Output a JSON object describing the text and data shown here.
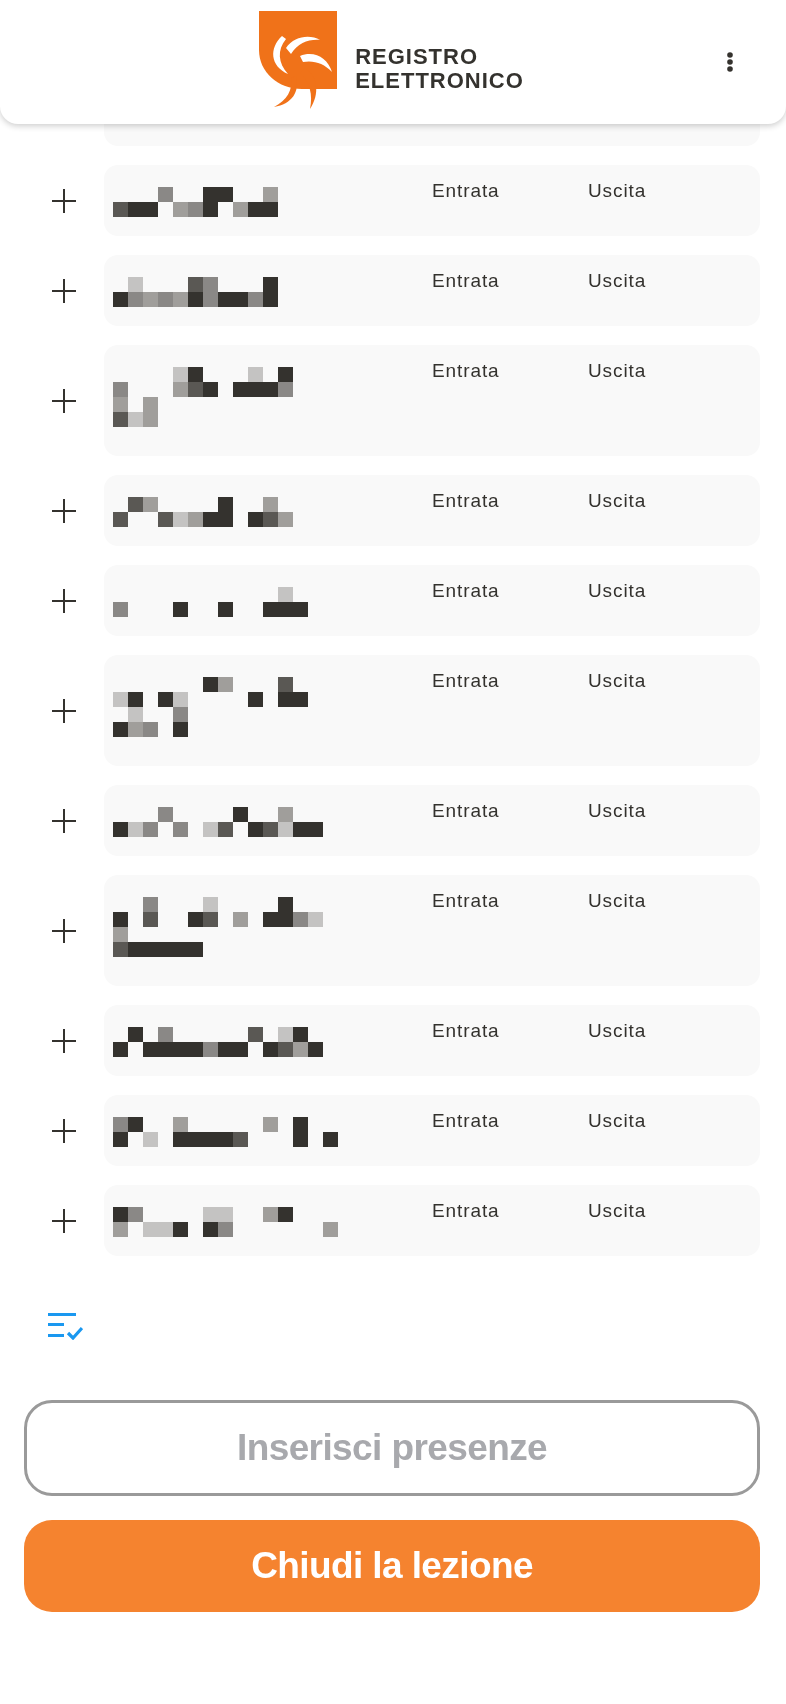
{
  "header": {
    "title": "REGISTRO ELETTRONICO"
  },
  "rows": [
    {
      "wrapped": false,
      "entry_label": "Entrata",
      "exit_label": "Uscita"
    },
    {
      "wrapped": false,
      "entry_label": "Entrata",
      "exit_label": "Uscita"
    },
    {
      "wrapped": true,
      "entry_label": "Entrata",
      "exit_label": "Uscita"
    },
    {
      "wrapped": false,
      "entry_label": "Entrata",
      "exit_label": "Uscita"
    },
    {
      "wrapped": false,
      "entry_label": "Entrata",
      "exit_label": "Uscita"
    },
    {
      "wrapped": true,
      "entry_label": "Entrata",
      "exit_label": "Uscita"
    },
    {
      "wrapped": false,
      "entry_label": "Entrata",
      "exit_label": "Uscita"
    },
    {
      "wrapped": true,
      "entry_label": "Entrata",
      "exit_label": "Uscita"
    },
    {
      "wrapped": false,
      "entry_label": "Entrata",
      "exit_label": "Uscita"
    },
    {
      "wrapped": false,
      "entry_label": "Entrata",
      "exit_label": "Uscita"
    },
    {
      "wrapped": false,
      "entry_label": "Entrata",
      "exit_label": "Uscita"
    }
  ],
  "buttons": [
    {
      "label": "Inserisci presenze",
      "kind": "outline",
      "disabled": true
    },
    {
      "label": "Chiudi la lezione",
      "kind": "filled",
      "disabled": false
    }
  ]
}
